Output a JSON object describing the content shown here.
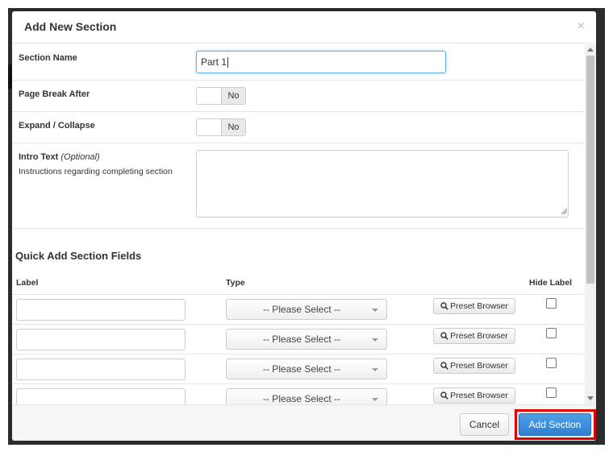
{
  "modal": {
    "title": "Add New Section",
    "close_glyph": "×"
  },
  "form": {
    "section_name": {
      "label": "Section Name",
      "value": "Part 1"
    },
    "page_break_after": {
      "label": "Page Break After",
      "toggle_value": "No"
    },
    "expand_collapse": {
      "label": "Expand / Collapse",
      "toggle_value": "No"
    },
    "intro_text": {
      "label": "Intro Text",
      "optional": "(Optional)",
      "help": "Instructions regarding completing section",
      "value": ""
    }
  },
  "quick_add": {
    "heading": "Quick Add Section Fields",
    "columns": {
      "label": "Label",
      "type": "Type",
      "hide_label": "Hide Label"
    },
    "rows": [
      {
        "label": "",
        "type": "-- Please Select --",
        "preset": "Preset Browser",
        "hide_label": false
      },
      {
        "label": "",
        "type": "-- Please Select --",
        "preset": "Preset Browser",
        "hide_label": false
      },
      {
        "label": "",
        "type": "-- Please Select --",
        "preset": "Preset Browser",
        "hide_label": false
      },
      {
        "label": "",
        "type": "-- Please Select --",
        "preset": "Preset Browser",
        "hide_label": false
      }
    ]
  },
  "footer": {
    "cancel_label": "Cancel",
    "submit_label": "Add Section"
  },
  "colors": {
    "primary": "#3a8ee0",
    "highlight": "#e00000",
    "focus": "#66afe9"
  },
  "icons": {
    "close": "close-icon",
    "preset": "search-icon"
  }
}
